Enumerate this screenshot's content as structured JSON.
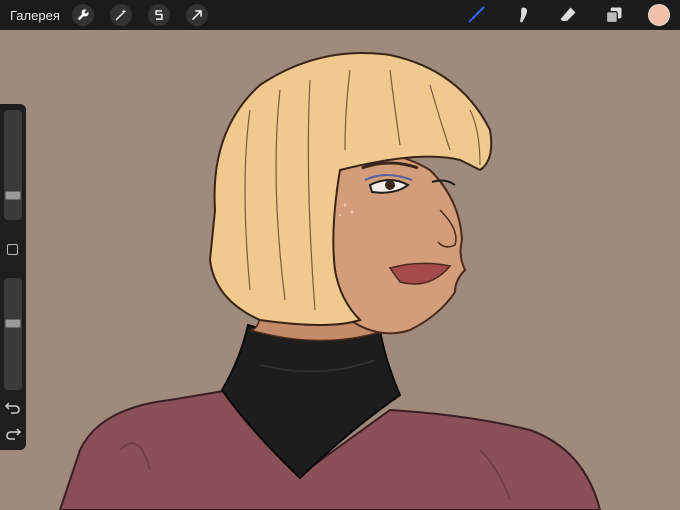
{
  "topbar": {
    "gallery_label": "Галерея",
    "tools": [
      "wrench-icon",
      "magic-wand-icon",
      "selection-icon",
      "transform-arrow-icon"
    ],
    "right_tools": [
      "brush-icon",
      "smudge-icon",
      "eraser-icon",
      "layers-icon"
    ],
    "active_tool": "brush-icon",
    "accent_color": "#2f6bff",
    "current_color": "#f2c0a6"
  },
  "sidebar": {
    "brush_size_level": 0.2,
    "opacity_level": 0.6,
    "icons": [
      "undo-icon",
      "redo-icon"
    ]
  },
  "canvas": {
    "background_color": "#a08a7e"
  }
}
